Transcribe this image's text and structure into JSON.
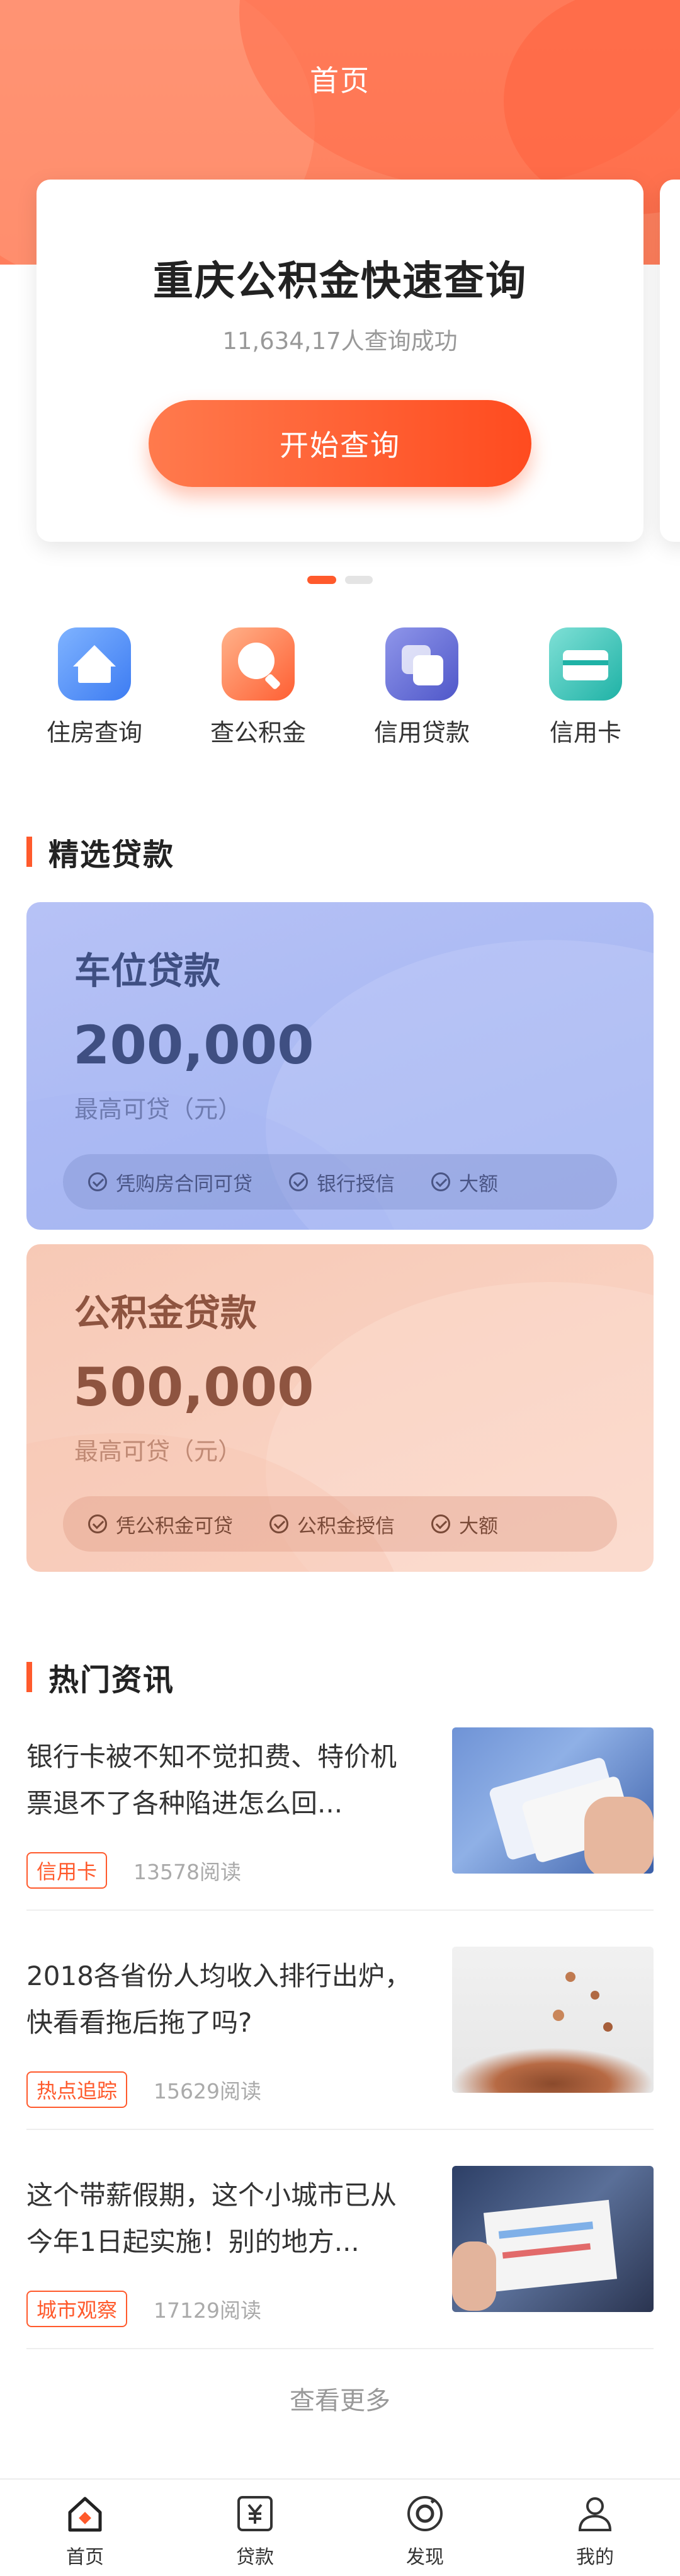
{
  "header": {
    "title": "首页"
  },
  "query": {
    "title": "重庆公积金快速查询",
    "subtitle": "11,634,17人查询成功",
    "button": "开始查询"
  },
  "quick_icons": [
    {
      "label": "住房查询",
      "icon": "house-icon"
    },
    {
      "label": "查公积金",
      "icon": "magnifier-icon"
    },
    {
      "label": "信用贷款",
      "icon": "overlap-squares-icon"
    },
    {
      "label": "信用卡",
      "icon": "credit-card-icon"
    }
  ],
  "loans": {
    "section_title": "精选贷款",
    "items": [
      {
        "name": "车位贷款",
        "amount": "200,000",
        "desc": "最高可贷（元）",
        "tags": [
          "凭购房合同可贷",
          "银行授信",
          "大额"
        ]
      },
      {
        "name": "公积金贷款",
        "amount": "500,000",
        "desc": "最高可贷（元）",
        "tags": [
          "凭公积金可贷",
          "公积金授信",
          "大额"
        ]
      }
    ]
  },
  "news": {
    "section_title": "热门资讯",
    "items": [
      {
        "title": "银行卡被不知不觉扣费、特价机票退不了各种陷进怎么回...",
        "tag": "信用卡",
        "reads": "13578阅读"
      },
      {
        "title": "2018各省份人均收入排行出炉，快看看拖后拖了吗?",
        "tag": "热点追踪",
        "reads": "15629阅读"
      },
      {
        "title": "这个带薪假期，这个小城市已从今年1日起实施！别的地方...",
        "tag": "城市观察",
        "reads": "17129阅读"
      }
    ],
    "more": "查看更多"
  },
  "tabbar": [
    {
      "label": "首页",
      "icon": "home-icon"
    },
    {
      "label": "贷款",
      "icon": "yuan-icon"
    },
    {
      "label": "发现",
      "icon": "compass-icon"
    },
    {
      "label": "我的",
      "icon": "person-icon"
    }
  ],
  "colors": {
    "accent": "#ff5a2c",
    "loan_blue_text": "#3f4f82",
    "loan_peach_text": "#8e5440"
  }
}
